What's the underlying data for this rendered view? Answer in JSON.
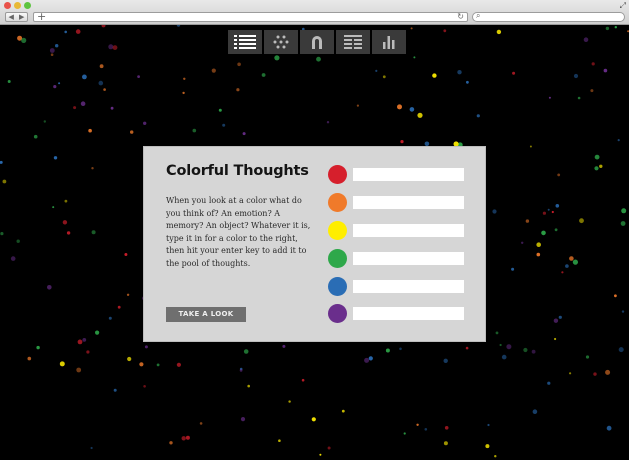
{
  "chrome": {
    "address_value": "",
    "search_value": ""
  },
  "toolbar": {
    "buttons": [
      {
        "icon": "list-icon"
      },
      {
        "icon": "dots-grid-icon"
      },
      {
        "icon": "magnet-icon"
      },
      {
        "icon": "columns-icon"
      },
      {
        "icon": "bar-chart-icon"
      }
    ]
  },
  "modal": {
    "title": "Colorful Thoughts",
    "description": "When you look at a color what do you think of? An emotion? A memory? An object? Whatever it is, type it in for a color to the right, then hit your enter key to add it to the pool of thoughts.",
    "button_label": "TAKE A LOOK",
    "colors": [
      {
        "name": "red",
        "hex": "#d61f2c",
        "value": ""
      },
      {
        "name": "orange",
        "hex": "#f07a2a",
        "value": ""
      },
      {
        "name": "yellow",
        "hex": "#ffee00",
        "value": ""
      },
      {
        "name": "green",
        "hex": "#2ea84a",
        "value": ""
      },
      {
        "name": "blue",
        "hex": "#2a6db5",
        "value": ""
      },
      {
        "name": "purple",
        "hex": "#6a2e8c",
        "value": ""
      }
    ]
  },
  "background": {
    "color": "#000000",
    "dot_colors": [
      "#d61f2c",
      "#f07a2a",
      "#ffee00",
      "#2ea84a",
      "#2a6db5",
      "#6a2e8c"
    ]
  }
}
